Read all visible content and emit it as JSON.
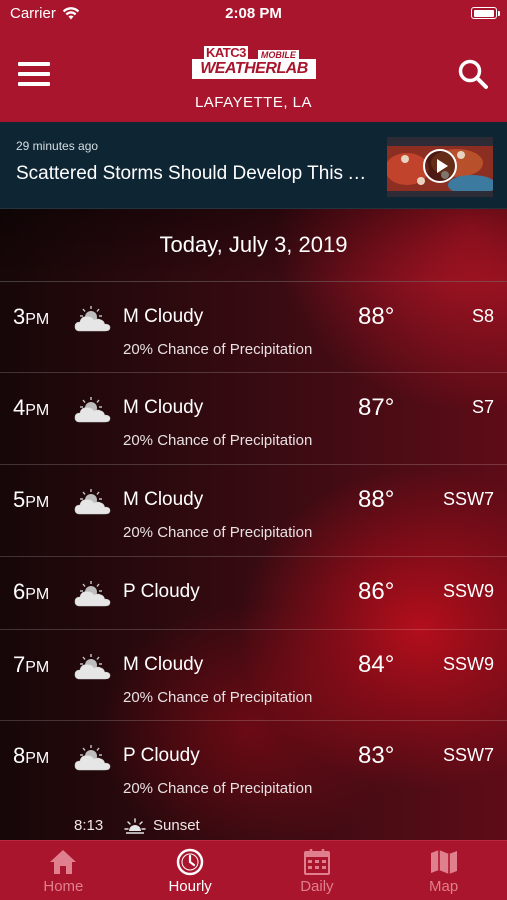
{
  "status_bar": {
    "carrier": "Carrier",
    "time": "2:08 PM",
    "battery_level": 1.0
  },
  "header": {
    "logo": {
      "katc": "KATC3",
      "mobile": "MOBILE",
      "main": "WEATHERLAB"
    },
    "location": "LAFAYETTE, LA",
    "menu_icon": "hamburger-menu-icon",
    "search_icon": "search-icon"
  },
  "news": {
    "age": "29 minutes ago",
    "title": "Scattered Storms Should Develop This Afternoon",
    "thumbnail_icon": "play-icon"
  },
  "forecast": {
    "date": "Today, July 3, 2019",
    "hours": [
      {
        "hour": "3",
        "ampm": "PM",
        "icon": "partly-cloudy-icon",
        "condition": "M Cloudy",
        "precip": "20% Chance of Precipitation",
        "temp": "88°",
        "wind": "S8"
      },
      {
        "hour": "4",
        "ampm": "PM",
        "icon": "partly-cloudy-icon",
        "condition": "M Cloudy",
        "precip": "20% Chance of Precipitation",
        "temp": "87°",
        "wind": "S7"
      },
      {
        "hour": "5",
        "ampm": "PM",
        "icon": "partly-cloudy-icon",
        "condition": "M Cloudy",
        "precip": "20% Chance of Precipitation",
        "temp": "88°",
        "wind": "SSW7"
      },
      {
        "hour": "6",
        "ampm": "PM",
        "icon": "partly-cloudy-icon",
        "condition": "P Cloudy",
        "precip": "",
        "temp": "86°",
        "wind": "SSW9"
      },
      {
        "hour": "7",
        "ampm": "PM",
        "icon": "partly-cloudy-icon",
        "condition": "M Cloudy",
        "precip": "20% Chance of Precipitation",
        "temp": "84°",
        "wind": "SSW9"
      },
      {
        "hour": "8",
        "ampm": "PM",
        "icon": "partly-cloudy-icon",
        "condition": "P Cloudy",
        "precip": "20% Chance of Precipitation",
        "temp": "83°",
        "wind": "SSW7"
      }
    ],
    "sunset": {
      "time": "8:13",
      "label": "Sunset",
      "icon": "sunset-icon"
    }
  },
  "tabs": [
    {
      "label": "Home",
      "icon": "home-icon",
      "active": false
    },
    {
      "label": "Hourly",
      "icon": "clock-icon",
      "active": true
    },
    {
      "label": "Daily",
      "icon": "calendar-icon",
      "active": false
    },
    {
      "label": "Map",
      "icon": "map-icon",
      "active": false
    }
  ],
  "colors": {
    "brand_red": "#a8152c",
    "news_bg": "#0e2533",
    "tab_inactive": "#e07f8d"
  }
}
